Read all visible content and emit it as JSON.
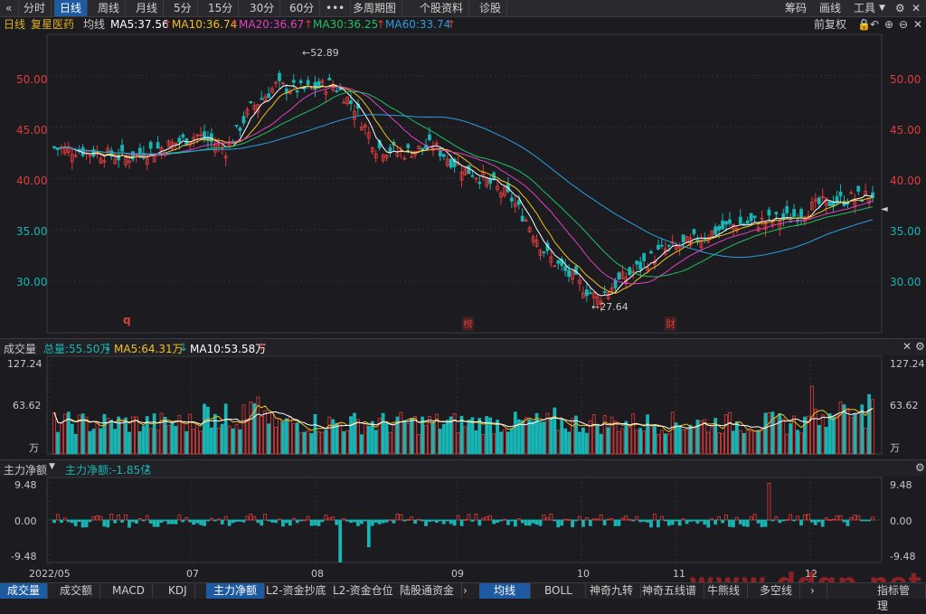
{
  "topbar": {
    "back_icon": "double-chevron-left-icon",
    "periods": [
      "分时",
      "日线",
      "周线",
      "月线",
      "5分",
      "15分",
      "30分",
      "60分"
    ],
    "active_period": "日线",
    "more_label": "•••",
    "multi_period": "多周期图",
    "stock_profile": "个股资料",
    "diagnose": "诊股",
    "right_items": [
      "筹码",
      "画线",
      "工具"
    ]
  },
  "info": {
    "period": "日线",
    "stock_name": "复星医药",
    "avg_label": "均线",
    "ma5": "MA5:37.56",
    "ma10": "MA10:36.74",
    "ma20": "MA20:36.67",
    "ma30": "MA30:36.25",
    "ma60": "MA60:33.74",
    "adjust": "前复权"
  },
  "colors": {
    "up": "#e03c3c",
    "down": "#19b4b4",
    "ma5": "#ffffff",
    "ma10": "#f0c020",
    "ma20": "#e040c0",
    "ma30": "#20c060",
    "ma60": "#2c9ce0"
  },
  "chart_data": [
    {
      "type": "candlestick",
      "y_ticks": [
        "50.00",
        "45.00",
        "40.00",
        "35.00",
        "30.00"
      ],
      "ylim": [
        25.0,
        54.0
      ],
      "high_label": "52.89",
      "low_label": "27.64",
      "markers": [
        "q",
        "榜",
        "财"
      ],
      "ma_levels": {
        "MA5": 37.56,
        "MA10": 36.74,
        "MA20": 36.67,
        "MA30": 36.25,
        "MA60": 33.74
      }
    },
    {
      "type": "bar",
      "title": "成交量",
      "total": "总量:55.50万",
      "ma5": "MA5:64.31万",
      "ma10": "MA10:53.58万",
      "y_ticks": [
        "127.24",
        "63.62",
        "万"
      ]
    },
    {
      "type": "bar",
      "title": "主力净额",
      "value": "主力净额:-1.85亿",
      "y_ticks": [
        "9.48",
        "0.00",
        "-9.48"
      ]
    }
  ],
  "x_axis": [
    "2022/05",
    "07",
    "08",
    "09",
    "10",
    "11",
    "12"
  ],
  "bottom_tabs": [
    "成交量",
    "成交额",
    "MACD",
    "KDJ",
    "主力净额",
    "L2-资金抄底",
    "L2-资金仓位",
    "陆股通资金",
    "均线",
    "BOLL",
    "神奇九转",
    "神奇五线谱",
    "牛熊线",
    "多空线",
    "指标管理"
  ],
  "watermark": "www.ddgp.net"
}
